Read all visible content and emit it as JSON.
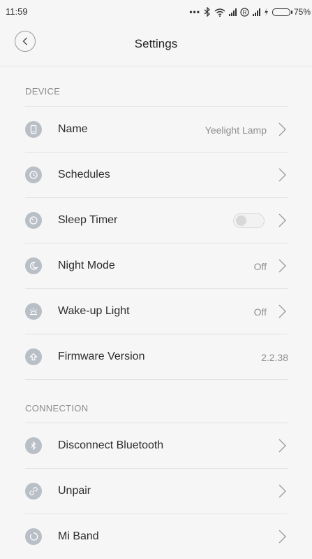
{
  "status": {
    "time": "11:59",
    "battery": "75%",
    "battery_level": 0.75
  },
  "header": {
    "title": "Settings"
  },
  "sections": {
    "device": "DEVICE",
    "connection": "CONNECTION"
  },
  "device": {
    "name": {
      "label": "Name",
      "value": "Yeelight Lamp"
    },
    "schedules": {
      "label": "Schedules"
    },
    "sleep_timer": {
      "label": "Sleep Timer",
      "enabled": false
    },
    "night_mode": {
      "label": "Night Mode",
      "value": "Off"
    },
    "wakeup_light": {
      "label": "Wake-up Light",
      "value": "Off"
    },
    "firmware": {
      "label": "Firmware Version",
      "value": "2.2.38"
    }
  },
  "connection": {
    "disconnect": {
      "label": "Disconnect Bluetooth"
    },
    "unpair": {
      "label": "Unpair"
    },
    "mi_band": {
      "label": "Mi Band"
    }
  },
  "colors": {
    "icon_bg": "#b9bfc6",
    "battery": "#21c24a"
  }
}
